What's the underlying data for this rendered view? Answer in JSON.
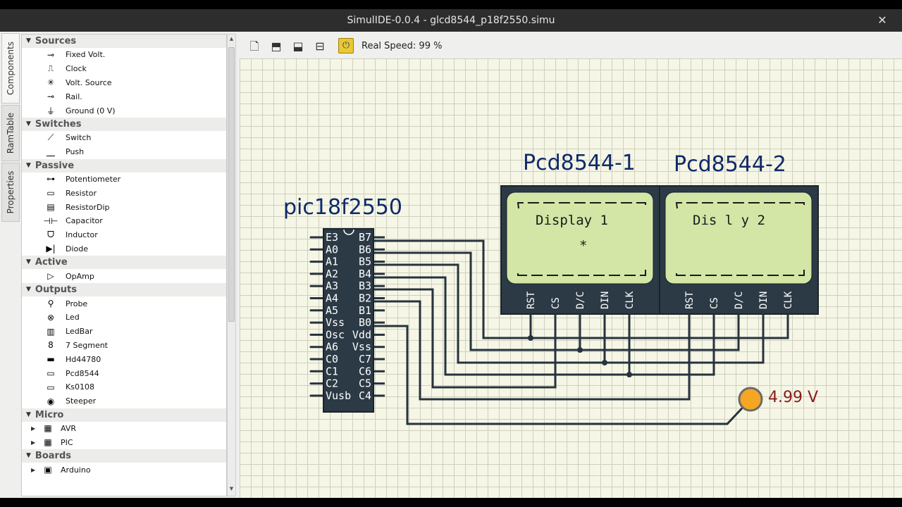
{
  "window": {
    "title": "SimulIDE-0.0.4  -  glcd8544_p18f2550.simu",
    "close_glyph": "✕"
  },
  "side_tabs": [
    "Components",
    "RamTable",
    "Properties"
  ],
  "components": [
    {
      "category": "Sources",
      "items": [
        {
          "label": "Fixed Volt.",
          "icon": "fixed-volt-icon"
        },
        {
          "label": "Clock",
          "icon": "clock-icon"
        },
        {
          "label": "Volt. Source",
          "icon": "volt-source-icon"
        },
        {
          "label": "Rail.",
          "icon": "rail-icon"
        },
        {
          "label": "Ground (0 V)",
          "icon": "ground-icon"
        }
      ]
    },
    {
      "category": "Switches",
      "items": [
        {
          "label": "Switch",
          "icon": "switch-icon"
        },
        {
          "label": "Push",
          "icon": "push-icon"
        }
      ]
    },
    {
      "category": "Passive",
      "items": [
        {
          "label": "Potentiometer",
          "icon": "potentiometer-icon"
        },
        {
          "label": "Resistor",
          "icon": "resistor-icon"
        },
        {
          "label": "ResistorDip",
          "icon": "resistor-dip-icon"
        },
        {
          "label": "Capacitor",
          "icon": "capacitor-icon"
        },
        {
          "label": "Inductor",
          "icon": "inductor-icon"
        },
        {
          "label": "Diode",
          "icon": "diode-icon"
        }
      ]
    },
    {
      "category": "Active",
      "items": [
        {
          "label": "OpAmp",
          "icon": "opamp-icon"
        }
      ]
    },
    {
      "category": "Outputs",
      "items": [
        {
          "label": "Probe",
          "icon": "probe-icon"
        },
        {
          "label": "Led",
          "icon": "led-icon"
        },
        {
          "label": "LedBar",
          "icon": "ledbar-icon"
        },
        {
          "label": "7 Segment",
          "icon": "seven-segment-icon"
        },
        {
          "label": "Hd44780",
          "icon": "hd44780-icon"
        },
        {
          "label": "Pcd8544",
          "icon": "pcd8544-icon"
        },
        {
          "label": "Ks0108",
          "icon": "ks0108-icon"
        },
        {
          "label": "Steeper",
          "icon": "stepper-icon"
        }
      ]
    },
    {
      "category": "Micro",
      "items": [
        {
          "label": "AVR",
          "icon": "chip-icon",
          "expandable": true
        },
        {
          "label": "PIC",
          "icon": "chip-icon",
          "expandable": true
        }
      ]
    },
    {
      "category": "Boards",
      "items": [
        {
          "label": "Arduino",
          "icon": "arduino-board-icon",
          "expandable": true
        }
      ]
    }
  ],
  "toolbar": {
    "buttons": [
      "new-circuit-icon",
      "open-circuit-icon",
      "save-circuit-icon",
      "save-as-icon"
    ],
    "power_icon": "power-icon",
    "speed_label": "Real Speed: 99 %"
  },
  "circuit": {
    "mcu": {
      "name": "pic18f2550",
      "left_pins": [
        "E3",
        "A0",
        "A1",
        "A2",
        "A3",
        "A4",
        "A5",
        "Vss",
        "Osc",
        "A6",
        "C0",
        "C1",
        "C2",
        "Vusb"
      ],
      "right_pins": [
        "B7",
        "B6",
        "B5",
        "B4",
        "B3",
        "B2",
        "B1",
        "B0",
        "Vdd",
        "Vss",
        "C7",
        "C6",
        "C5",
        "C4"
      ]
    },
    "displays": [
      {
        "name": "Pcd8544-1",
        "line1": "Display 1",
        "line2": "*",
        "pins": [
          "RST",
          "CS",
          "D/C",
          "DIN",
          "CLK"
        ]
      },
      {
        "name": "Pcd8544-2",
        "line1": "Dis l y 2",
        "line2": "",
        "pins": [
          "RST",
          "CS",
          "D/C",
          "DIN",
          "CLK"
        ]
      }
    ],
    "probe": {
      "reading": "4.99 V",
      "color": "#f5a623"
    },
    "colors": {
      "wire": "#26333d",
      "chip": "#2b3a45",
      "lcd_screen": "#d3e6a6",
      "lcd_body": "#2b3a45"
    }
  }
}
